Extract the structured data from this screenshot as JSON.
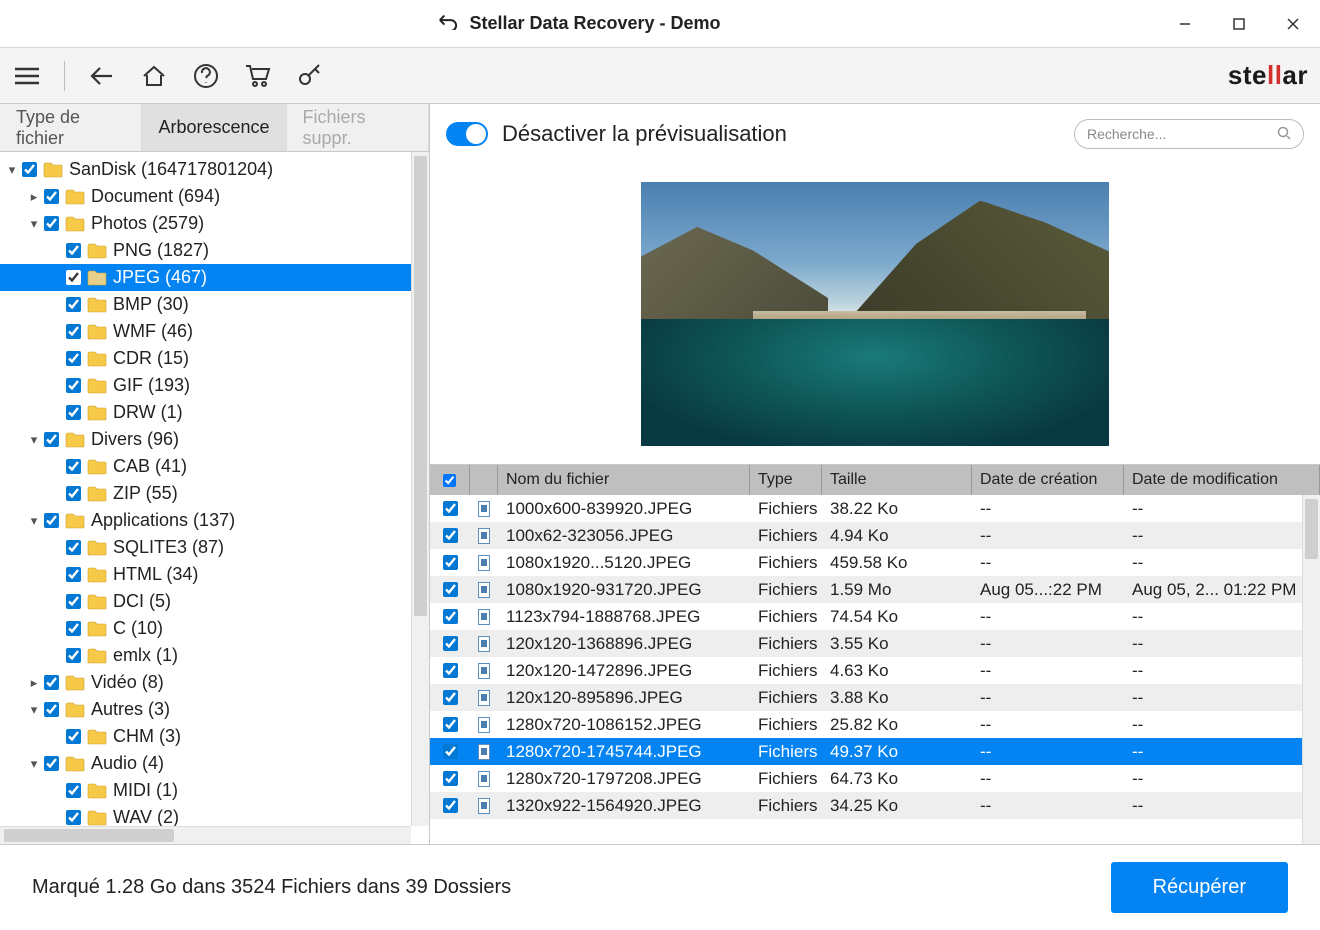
{
  "title": "Stellar Data Recovery - Demo",
  "brand": {
    "pre": "ste",
    "red": "ll",
    "post": "ar"
  },
  "tabs": {
    "type": "Type de fichier",
    "tree": "Arborescence",
    "deleted": "Fichiers suppr."
  },
  "tree": [
    {
      "indent": 0,
      "caret": "▾",
      "label": "SanDisk (164717801204)"
    },
    {
      "indent": 1,
      "caret": "▸",
      "label": "Document (694)"
    },
    {
      "indent": 1,
      "caret": "▾",
      "label": "Photos (2579)"
    },
    {
      "indent": 2,
      "caret": "",
      "label": "PNG (1827)"
    },
    {
      "indent": 2,
      "caret": "",
      "label": "JPEG (467)",
      "selected": true,
      "open": true
    },
    {
      "indent": 2,
      "caret": "",
      "label": "BMP (30)"
    },
    {
      "indent": 2,
      "caret": "",
      "label": "WMF (46)"
    },
    {
      "indent": 2,
      "caret": "",
      "label": "CDR (15)"
    },
    {
      "indent": 2,
      "caret": "",
      "label": "GIF (193)"
    },
    {
      "indent": 2,
      "caret": "",
      "label": "DRW (1)"
    },
    {
      "indent": 1,
      "caret": "▾",
      "label": "Divers (96)"
    },
    {
      "indent": 2,
      "caret": "",
      "label": "CAB (41)"
    },
    {
      "indent": 2,
      "caret": "",
      "label": "ZIP (55)"
    },
    {
      "indent": 1,
      "caret": "▾",
      "label": "Applications (137)"
    },
    {
      "indent": 2,
      "caret": "",
      "label": "SQLITE3 (87)"
    },
    {
      "indent": 2,
      "caret": "",
      "label": "HTML (34)"
    },
    {
      "indent": 2,
      "caret": "",
      "label": "DCI (5)"
    },
    {
      "indent": 2,
      "caret": "",
      "label": "C (10)"
    },
    {
      "indent": 2,
      "caret": "",
      "label": "emlx (1)"
    },
    {
      "indent": 1,
      "caret": "▸",
      "label": "Vidéo (8)"
    },
    {
      "indent": 1,
      "caret": "▾",
      "label": "Autres (3)"
    },
    {
      "indent": 2,
      "caret": "",
      "label": "CHM (3)"
    },
    {
      "indent": 1,
      "caret": "▾",
      "label": "Audio (4)"
    },
    {
      "indent": 2,
      "caret": "",
      "label": "MIDI (1)"
    },
    {
      "indent": 2,
      "caret": "",
      "label": "WAV (2)"
    }
  ],
  "preview_toggle_label": "Désactiver la prévisualisation",
  "search_placeholder": "Recherche...",
  "columns": {
    "name": "Nom du fichier",
    "type": "Type",
    "size": "Taille",
    "created": "Date de création",
    "modified": "Date de modification"
  },
  "files": [
    {
      "name": "1000x600-839920.JPEG",
      "type": "Fichiers",
      "size": "38.22 Ko",
      "created": "--",
      "modified": "--"
    },
    {
      "name": "100x62-323056.JPEG",
      "type": "Fichiers",
      "size": "4.94 Ko",
      "created": "--",
      "modified": "--"
    },
    {
      "name": "1080x1920...5120.JPEG",
      "type": "Fichiers",
      "size": "459.58 Ko",
      "created": "--",
      "modified": "--"
    },
    {
      "name": "1080x1920-931720.JPEG",
      "type": "Fichiers",
      "size": "1.59 Mo",
      "created": "Aug 05...:22 PM",
      "modified": "Aug 05, 2... 01:22 PM"
    },
    {
      "name": "1123x794-1888768.JPEG",
      "type": "Fichiers",
      "size": "74.54 Ko",
      "created": "--",
      "modified": "--"
    },
    {
      "name": "120x120-1368896.JPEG",
      "type": "Fichiers",
      "size": "3.55 Ko",
      "created": "--",
      "modified": "--"
    },
    {
      "name": "120x120-1472896.JPEG",
      "type": "Fichiers",
      "size": "4.63 Ko",
      "created": "--",
      "modified": "--"
    },
    {
      "name": "120x120-895896.JPEG",
      "type": "Fichiers",
      "size": "3.88 Ko",
      "created": "--",
      "modified": "--"
    },
    {
      "name": "1280x720-1086152.JPEG",
      "type": "Fichiers",
      "size": "25.82 Ko",
      "created": "--",
      "modified": "--"
    },
    {
      "name": "1280x720-1745744.JPEG",
      "type": "Fichiers",
      "size": "49.37 Ko",
      "created": "--",
      "modified": "--",
      "selected": true
    },
    {
      "name": "1280x720-1797208.JPEG",
      "type": "Fichiers",
      "size": "64.73 Ko",
      "created": "--",
      "modified": "--"
    },
    {
      "name": "1320x922-1564920.JPEG",
      "type": "Fichiers",
      "size": "34.25 Ko",
      "created": "--",
      "modified": "--"
    }
  ],
  "status_text": "Marqué 1.28 Go dans 3524 Fichiers dans 39 Dossiers",
  "recover_button": "Récupérer"
}
